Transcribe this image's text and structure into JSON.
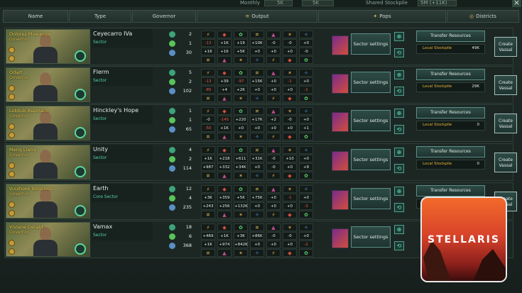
{
  "topbar": {
    "monthly_label": "Monthly",
    "values": [
      "5K",
      "5K"
    ],
    "shared_stockpile_label": "Shared Stockpile",
    "shared_stockpile_value": "5M (+11K)",
    "close_icon": "close-icon"
  },
  "header": {
    "name": "Name",
    "type": "Type",
    "governor": "Governor",
    "output": "Output",
    "pops": "Pops",
    "districts": "Districts"
  },
  "rows": [
    {
      "governor_name": "Dolores Muwanga",
      "governor_role": "Governor",
      "level": "",
      "sector_name": "Ceyecarro IVa",
      "sector_type": "Sector",
      "pops": [
        "2",
        "1",
        "30"
      ],
      "output": [
        [
          "-13",
          "+1K",
          "+19",
          "+10K",
          "-0",
          "-0",
          "+0"
        ],
        [
          "+16",
          "+16",
          "+5K",
          "+0",
          "+0",
          "+0",
          "-0"
        ]
      ],
      "settings_label": "Sector settings",
      "transfer_label": "Transfer Resources",
      "stockpile_label": "Local Stockpile",
      "stockpile_value": "49K",
      "vassal_label": "Create Vassal"
    },
    {
      "governor_name": "Odart",
      "governor_role": "Governor",
      "level": "",
      "sector_name": "Flerm",
      "sector_type": "Sector",
      "pops": [
        "5",
        "2",
        "102"
      ],
      "output": [
        [
          "-13",
          "+39",
          "-97",
          "+15K",
          "+0",
          "-1",
          "+0"
        ],
        [
          "-85",
          "+4",
          "+2K",
          "+0",
          "+0",
          "+0",
          "-1"
        ]
      ],
      "settings_label": "Sector settings",
      "transfer_label": "Transfer Resources",
      "stockpile_label": "Local Stockpile",
      "stockpile_value": "29K",
      "vassal_label": "Create Vassal"
    },
    {
      "governor_name": "Lobbuk Aspinaco",
      "governor_role": "Governor",
      "level": "",
      "sector_name": "Hinckley's Hope",
      "sector_type": "Sector",
      "pops": [
        "1",
        "1",
        "65"
      ],
      "output": [
        [
          "-0",
          "-145",
          "+220",
          "+17K",
          "+2",
          "-0",
          "+0"
        ],
        [
          "-50",
          "+1K",
          "+0",
          "+0",
          "+0",
          "+0",
          "+1"
        ]
      ],
      "settings_label": "Sector settings",
      "transfer_label": "Transfer Resources",
      "stockpile_label": "Local Stockpile",
      "stockpile_value": "0",
      "vassal_label": "Create Vassal"
    },
    {
      "governor_name": "Meng Liang",
      "governor_role": "Governor",
      "level": "",
      "sector_name": "Unity",
      "sector_type": "Sector",
      "pops": [
        "4",
        "2",
        "114"
      ],
      "output": [
        [
          "+1K",
          "+218",
          "+611",
          "+31K",
          "-0",
          "+10",
          "+0"
        ],
        [
          "+987",
          "+332",
          "+34K",
          "+0",
          "-0",
          "+0",
          "+9"
        ]
      ],
      "settings_label": "Sector settings",
      "transfer_label": "Transfer Resources",
      "stockpile_label": "Local Stockpile",
      "stockpile_value": "0",
      "vassal_label": "Create Vassal"
    },
    {
      "governor_name": "Vuulhokk Brigsloop",
      "governor_role": "Governor",
      "level": "",
      "sector_name": "Earth",
      "sector_type": "Core Sector",
      "pops": [
        "12",
        "4",
        "235"
      ],
      "output": [
        [
          "+3K",
          "+359",
          "+5K",
          "+75K",
          "+0",
          "-1",
          "+0"
        ],
        [
          "+243",
          "+256",
          "+132K",
          "+0",
          "+0",
          "+0",
          "-3"
        ]
      ],
      "settings_label": "Sector settings",
      "transfer_label": "Transfer Resources",
      "stockpile_label": "Local Stockpile",
      "stockpile_value": "",
      "vassal_label": "Create Vassal"
    },
    {
      "governor_name": "Viviane Gerald",
      "governor_role": "Governor",
      "level": "",
      "sector_name": "Vamax",
      "sector_type": "Sector",
      "pops": [
        "18",
        "6",
        "368"
      ],
      "output": [
        [
          "+469",
          "+1K",
          "+3K",
          "+86K",
          "-0",
          "-0",
          "+0"
        ],
        [
          "+1K",
          "+974",
          "+842K",
          "+0",
          "+0",
          "+0",
          "-2"
        ]
      ],
      "settings_label": "Sector settings",
      "transfer_label": "",
      "stockpile_label": "",
      "stockpile_value": "",
      "vassal_label": ""
    }
  ],
  "output_icons": [
    "energy-icon",
    "minerals-icon",
    "food-icon",
    "trade-icon",
    "alloys-icon",
    "unity-icon",
    "research-icon"
  ],
  "logo": {
    "text": "STELLARIS"
  },
  "colors": {
    "accent": "#52d3a3",
    "gold": "#e8b43a",
    "negative": "#ef5a4a"
  }
}
